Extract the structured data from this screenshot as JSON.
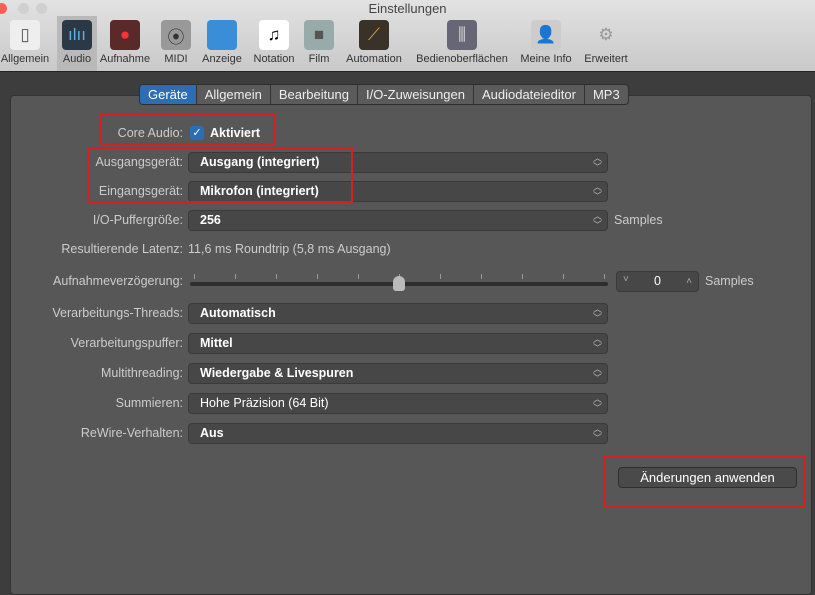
{
  "window": {
    "title": "Einstellungen"
  },
  "toolbar": [
    {
      "label": "Allgemein",
      "icon": "switch-icon"
    },
    {
      "label": "Audio",
      "icon": "waveform-icon",
      "selected": true
    },
    {
      "label": "Aufnahme",
      "icon": "record-icon"
    },
    {
      "label": "MIDI",
      "icon": "midi-plug-icon"
    },
    {
      "label": "Anzeige",
      "icon": "monitor-icon"
    },
    {
      "label": "Notation",
      "icon": "note-icon"
    },
    {
      "label": "Film",
      "icon": "camera-icon"
    },
    {
      "label": "Automation",
      "icon": "automation-icon"
    },
    {
      "label": "Bedienoberflächen",
      "icon": "faders-icon"
    },
    {
      "label": "Meine Info",
      "icon": "user-icon"
    },
    {
      "label": "Erweitert",
      "icon": "gear-icon"
    }
  ],
  "tabs": [
    "Geräte",
    "Allgemein",
    "Bearbeitung",
    "I/O-Zuweisungen",
    "Audiodateieditor",
    "MP3"
  ],
  "form": {
    "core_audio_label": "Core Audio:",
    "core_audio_value": "Aktiviert",
    "output_label": "Ausgangsgerät:",
    "output_value": "Ausgang (integriert)",
    "input_label": "Eingangsgerät:",
    "input_value": "Mikrofon (integriert)",
    "buffer_label": "I/O-Puffergröße:",
    "buffer_value": "256",
    "buffer_unit": "Samples",
    "latency_label": "Resultierende Latenz:",
    "latency_value": "11,6 ms Roundtrip (5,8 ms Ausgang)",
    "delay_label": "Aufnahmeverzögerung:",
    "delay_value": "0",
    "delay_unit": "Samples",
    "delay_slider_fraction": 0.5,
    "threads_label": "Verarbeitungs-Threads:",
    "threads_value": "Automatisch",
    "procbuf_label": "Verarbeitungspuffer:",
    "procbuf_value": "Mittel",
    "multi_label": "Multithreading:",
    "multi_value": "Wiedergabe & Livespuren",
    "sum_label": "Summieren:",
    "sum_value": "Hohe Präzision (64 Bit)",
    "rewire_label": "ReWire-Verhalten:",
    "rewire_value": "Aus",
    "apply_label": "Änderungen anwenden"
  }
}
